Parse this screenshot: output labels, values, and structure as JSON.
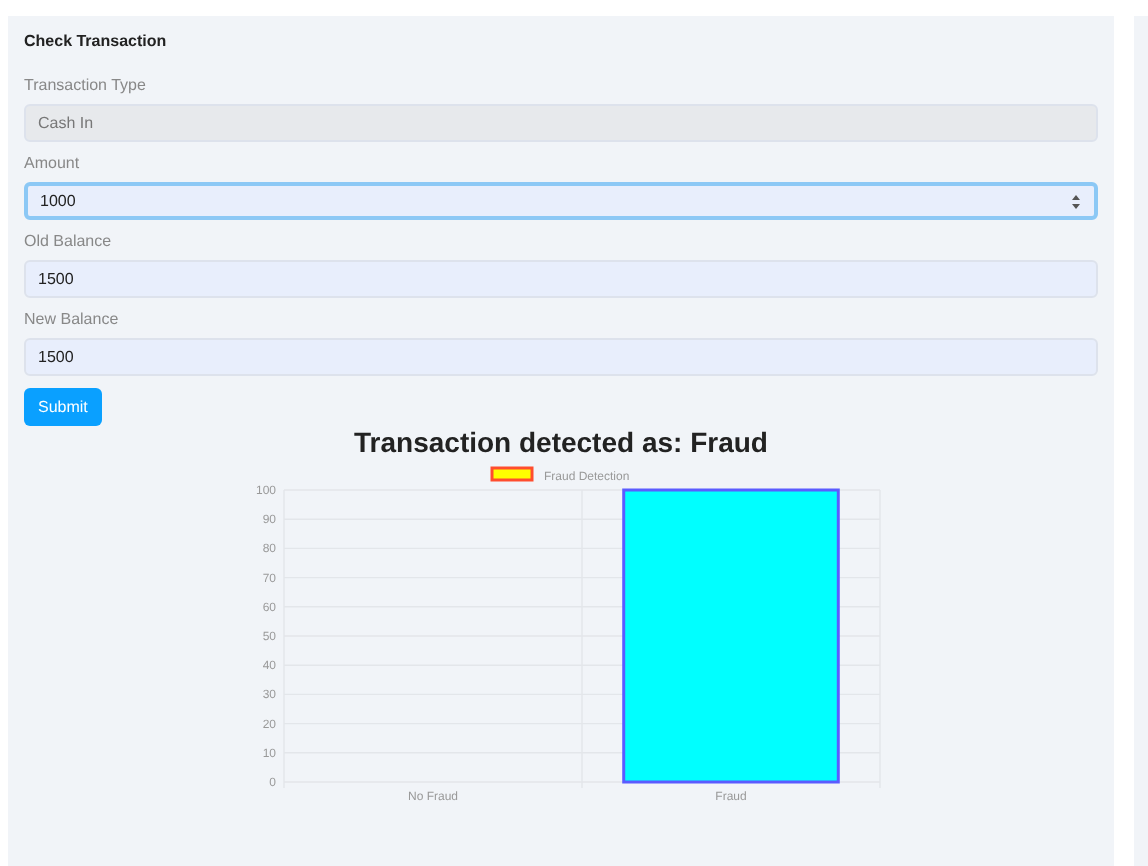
{
  "form": {
    "title": "Check Transaction",
    "fields": [
      {
        "label": "Transaction Type",
        "value": "Cash In",
        "disabled": true,
        "focused": false,
        "kind": "text"
      },
      {
        "label": "Amount",
        "value": "1000",
        "disabled": false,
        "focused": true,
        "kind": "number"
      },
      {
        "label": "Old Balance",
        "value": "1500",
        "disabled": false,
        "focused": false,
        "kind": "text"
      },
      {
        "label": "New Balance",
        "value": "1500",
        "disabled": false,
        "focused": false,
        "kind": "text"
      }
    ],
    "submit": "Submit"
  },
  "result": {
    "heading": "Transaction detected as: Fraud",
    "chart_data": {
      "type": "bar",
      "grid": true,
      "categories": [
        "No Fraud",
        "Fraud"
      ],
      "series": [
        {
          "name": "Fraud Detection",
          "color": "#00ffff",
          "values": [
            0,
            100
          ]
        }
      ],
      "ylim": [
        0,
        100
      ],
      "yticks": [
        0,
        10,
        20,
        30,
        40,
        50,
        60,
        70,
        80,
        90,
        100
      ]
    }
  }
}
